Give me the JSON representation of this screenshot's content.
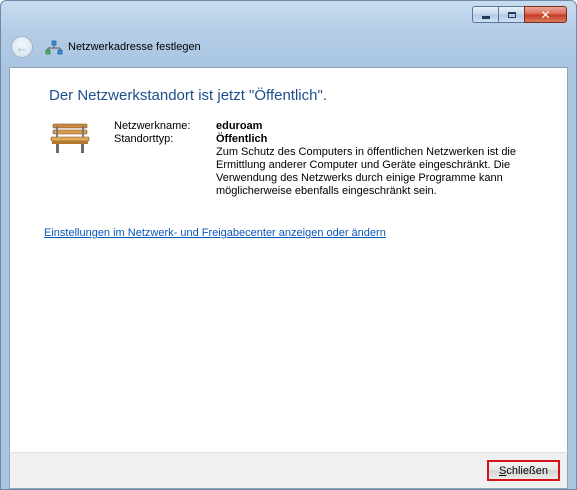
{
  "window": {
    "title": "Netzwerkadresse festlegen"
  },
  "icons": {
    "back": "back-arrow-icon",
    "network": "network-icon",
    "bench": "park-bench-icon",
    "minimize": "minimize-icon",
    "maximize": "maximize-icon",
    "close": "close-icon"
  },
  "main": {
    "heading": "Der Netzwerkstandort ist jetzt \"Öffentlich\".",
    "network_name_label": "Netzwerkname:",
    "network_name_value": "eduroam",
    "location_type_label": "Standorttyp:",
    "location_type_value": "Öffentlich",
    "description": "Zum Schutz des Computers in öffentlichen Netzwerken ist die Ermittlung anderer Computer und Geräte eingeschränkt. Die Verwendung des Netzwerks durch einige Programme kann möglicherweise ebenfalls eingeschränkt sein.",
    "settings_link": "Einstellungen im Netzwerk- und Freigabecenter anzeigen oder ändern"
  },
  "footer": {
    "close_accel": "S",
    "close_rest": "chließen"
  },
  "colors": {
    "heading": "#1e4f8d",
    "link": "#0a56b8",
    "close_highlight": "#d4121a",
    "frame": "#b4cde6"
  }
}
